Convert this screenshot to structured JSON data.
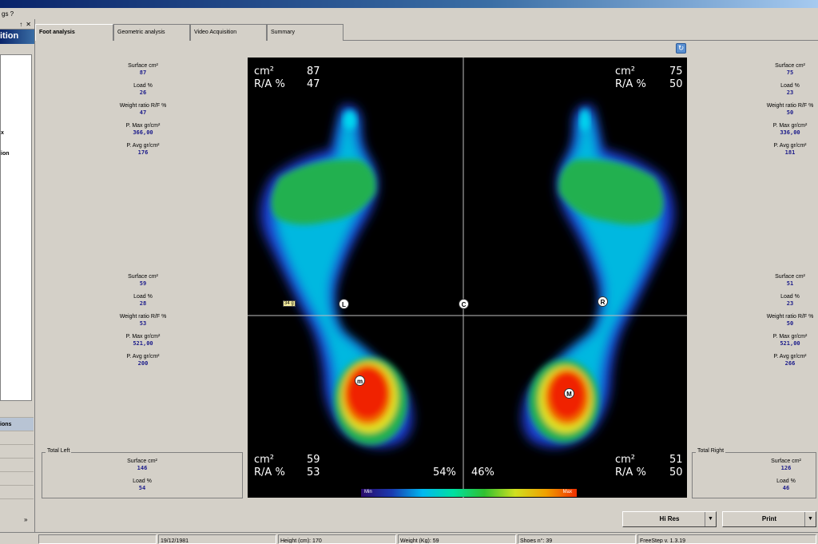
{
  "menubar": {
    "text": "gs  ?"
  },
  "left_panel": {
    "controls": [
      "↑",
      "✕"
    ],
    "title": "ition",
    "fragments": [
      "x",
      "ion"
    ],
    "rows": [
      "",
      "ions",
      "",
      "",
      "",
      "",
      "",
      ""
    ]
  },
  "tabs": [
    "Foot analysis",
    "Geometric analysis",
    "Video Acquisition",
    "Summary"
  ],
  "stats": {
    "left_fore": {
      "surface_label": "Surface cm²",
      "surface": "87",
      "load_label": "Load %",
      "load": "26",
      "ratio_label": "Weight ratio R/F %",
      "ratio": "47",
      "pmax_label": "P. Max gr/cm²",
      "pmax": "366,00",
      "pavg_label": "P. Avg gr/cm²",
      "pavg": "176"
    },
    "left_rear": {
      "surface_label": "Surface cm²",
      "surface": "59",
      "load_label": "Load %",
      "load": "28",
      "ratio_label": "Weight ratio R/F %",
      "ratio": "53",
      "pmax_label": "P. Max gr/cm²",
      "pmax": "521,00",
      "pavg_label": "P. Avg gr/cm²",
      "pavg": "200"
    },
    "right_fore": {
      "surface_label": "Surface cm²",
      "surface": "75",
      "load_label": "Load %",
      "load": "23",
      "ratio_label": "Weight ratio R/F %",
      "ratio": "50",
      "pmax_label": "P. Max gr/cm²",
      "pmax": "336,00",
      "pavg_label": "P. Avg gr/cm²",
      "pavg": "181"
    },
    "right_rear": {
      "surface_label": "Surface cm²",
      "surface": "51",
      "load_label": "Load %",
      "load": "23",
      "ratio_label": "Weight ratio R/F %",
      "ratio": "50",
      "pmax_label": "P. Max gr/cm²",
      "pmax": "521,00",
      "pavg_label": "P. Avg gr/cm²",
      "pavg": "266"
    }
  },
  "totals": {
    "left": {
      "legend": "Total Left",
      "surface_label": "Surface cm²",
      "surface": "146",
      "load_label": "Load %",
      "load": "54"
    },
    "right": {
      "legend": "Total Right",
      "surface_label": "Surface cm²",
      "surface": "126",
      "load_label": "Load %",
      "load": "46"
    }
  },
  "canvas": {
    "tl": {
      "k1": "cm²",
      "v1": "87",
      "k2": "R/A %",
      "v2": "47"
    },
    "tr": {
      "k1": "cm²",
      "v1": "75",
      "k2": "R/A %",
      "v2": "50"
    },
    "bl": {
      "k1": "cm²",
      "v1": "59",
      "k2": "R/A %",
      "v2": "53"
    },
    "br": {
      "k1": "cm²",
      "v1": "51",
      "k2": "R/A %",
      "v2": "50"
    },
    "pct_left": "54%",
    "pct_right": "46%",
    "markers": {
      "L": "L",
      "C": "C",
      "R": "R",
      "m": "m",
      "M": "M"
    },
    "tag": "34 g",
    "scale_min": "Min",
    "scale_max": "Max"
  },
  "buttons": {
    "hires": "Hi Res",
    "print": "Print",
    "dropdown": "▼"
  },
  "refresh_icon": "↻",
  "status": {
    "date": "19/12/1981",
    "height": "Height (cm): 170",
    "weight": "Weight (Kg): 59",
    "shoes": "Shoes n°: 39",
    "version": "FreeStep v. 1.3.19"
  },
  "colors": {
    "canvas_bg": "#000000",
    "value_blue": "#1a1a8a",
    "title_blue": "#0a246a"
  }
}
